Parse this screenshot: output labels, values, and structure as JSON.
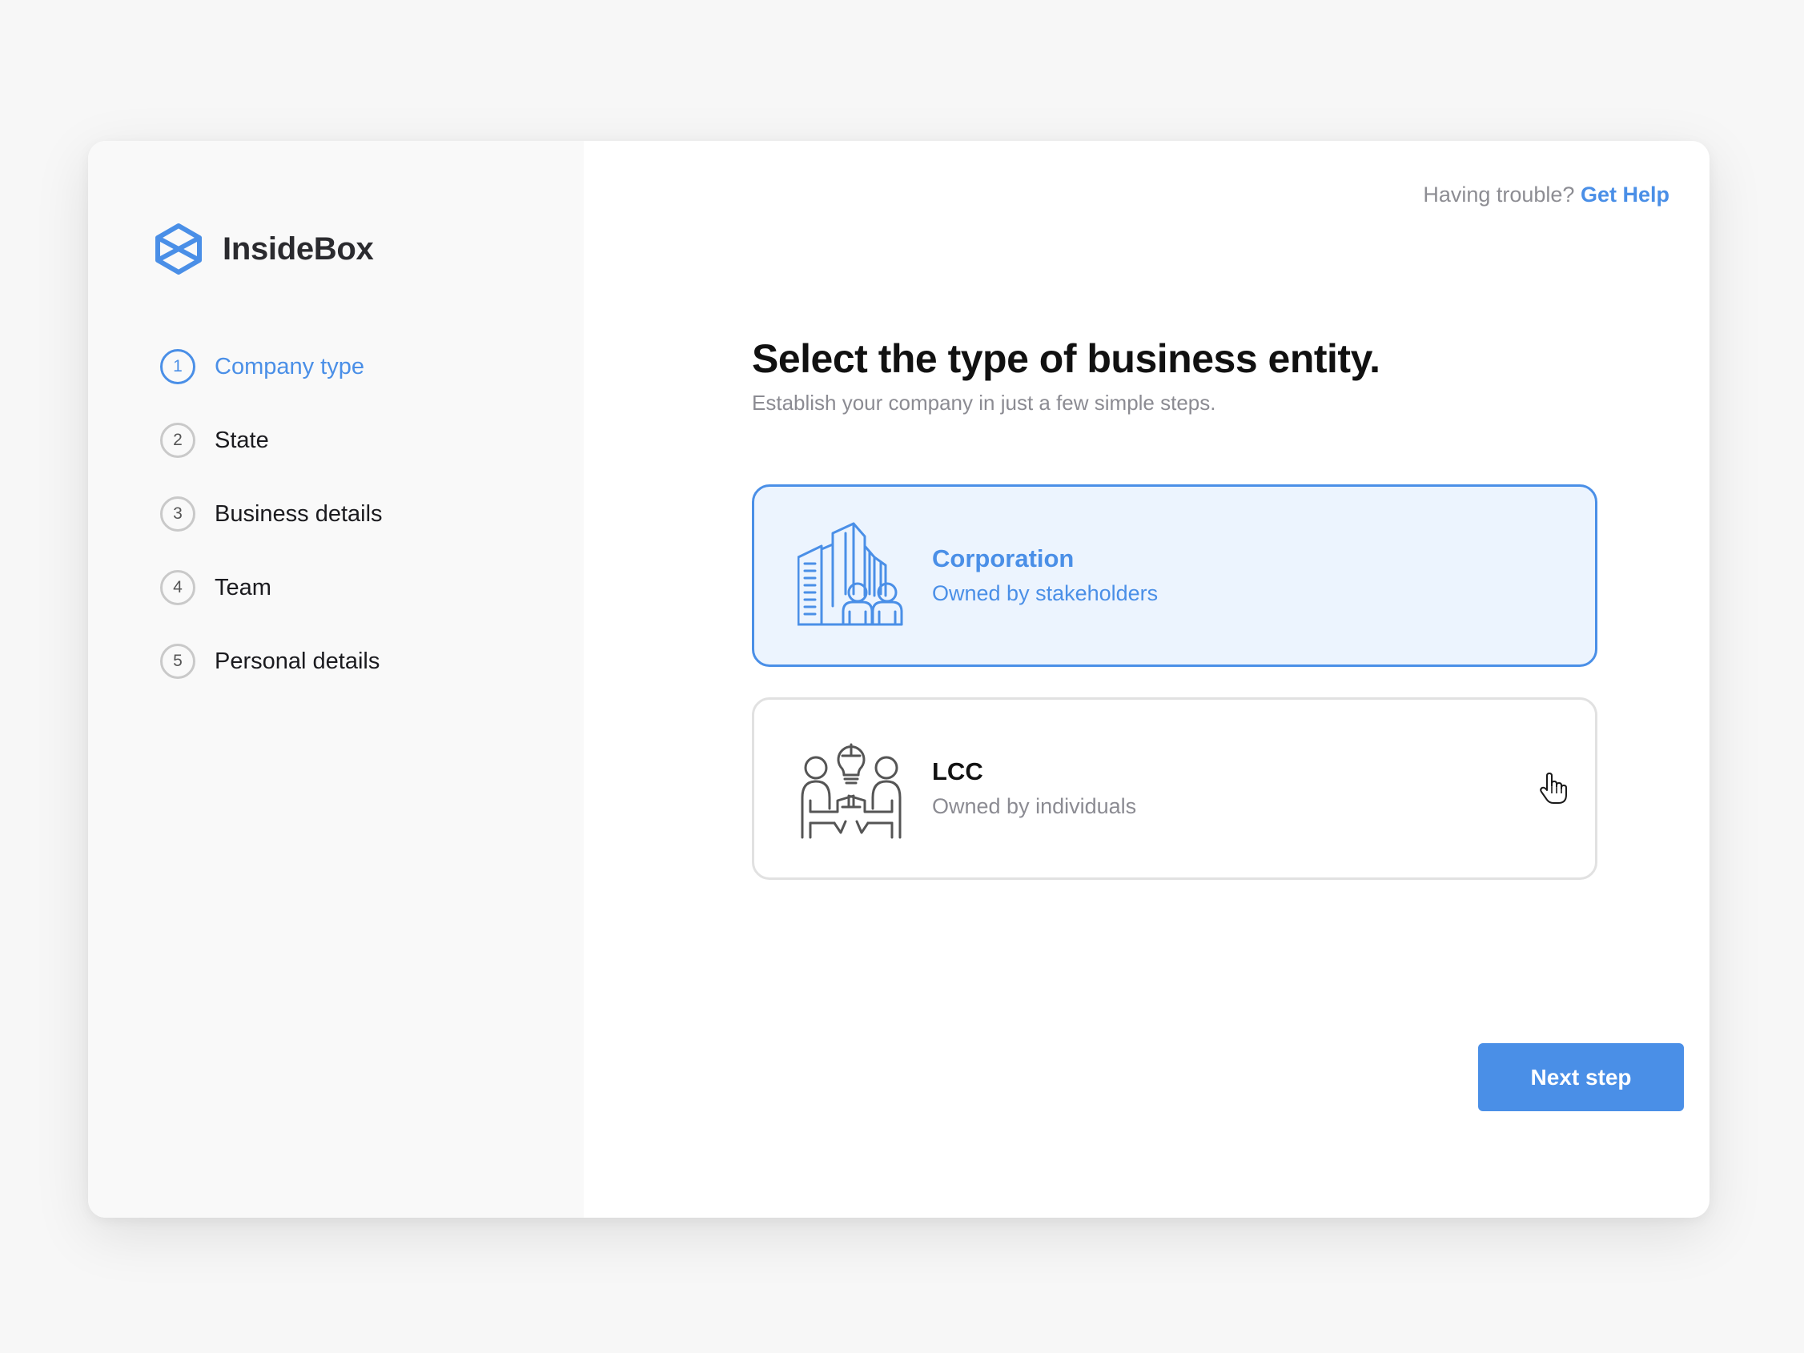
{
  "brand": {
    "name": "InsideBox",
    "color": "#4a8fe7"
  },
  "steps": [
    {
      "number": "1",
      "label": "Company type",
      "active": true
    },
    {
      "number": "2",
      "label": "State",
      "active": false
    },
    {
      "number": "3",
      "label": "Business details",
      "active": false
    },
    {
      "number": "4",
      "label": "Team",
      "active": false
    },
    {
      "number": "5",
      "label": "Personal details",
      "active": false
    }
  ],
  "header": {
    "help_prompt": "Having trouble?",
    "help_link": "Get Help"
  },
  "main": {
    "title": "Select the type of business entity.",
    "subtitle": "Establish your company in just a few simple steps."
  },
  "options": [
    {
      "title": "Corporation",
      "description": "Owned by stakeholders",
      "icon": "buildings-people-icon",
      "selected": true
    },
    {
      "title": "LCC",
      "description": "Owned by individuals",
      "icon": "partners-idea-icon",
      "selected": false
    }
  ],
  "actions": {
    "next_label": "Next step"
  },
  "colors": {
    "accent": "#4a8fe7",
    "selected_bg": "#ecf4fe",
    "text": "#111111",
    "muted": "#8b8b92"
  }
}
